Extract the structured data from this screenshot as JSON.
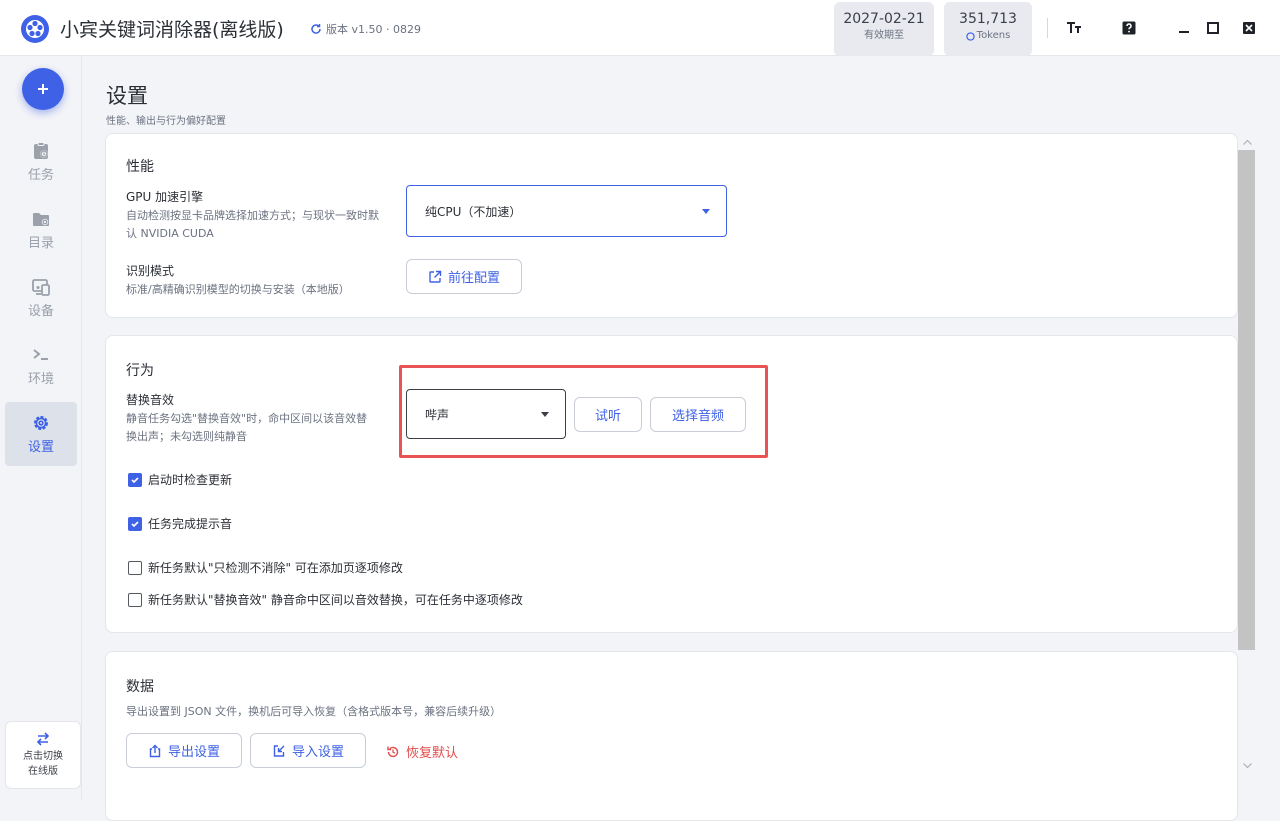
{
  "app": {
    "title": "小宾关键词消除器(离线版)",
    "version_label": "版本 v1.50 · 0829"
  },
  "stats": {
    "expiry_value": "2027-02-21",
    "expiry_label": "有效期至",
    "tokens_value": "351,713",
    "tokens_label": "Tokens"
  },
  "sidebar": {
    "items": [
      {
        "label": "任务",
        "icon": "task-icon"
      },
      {
        "label": "目录",
        "icon": "folder-icon"
      },
      {
        "label": "设备",
        "icon": "device-icon"
      },
      {
        "label": "环境",
        "icon": "terminal-icon"
      },
      {
        "label": "设置",
        "icon": "gear-icon",
        "active": true
      }
    ],
    "switch_line1": "点击切换",
    "switch_line2": "在线版"
  },
  "page": {
    "title": "设置",
    "subtitle": "性能、输出与行为偏好配置"
  },
  "performance": {
    "title": "性能",
    "gpu_label": "GPU 加速引擎",
    "gpu_desc": "自动检测按显卡品牌选择加速方式；与现状一致时默认 NVIDIA CUDA",
    "gpu_value": "纯CPU（不加速）",
    "mode_label": "识别模式",
    "mode_desc": "标准/高精确识别模型的切换与安装（本地版）",
    "mode_button": "前往配置"
  },
  "behavior": {
    "title": "行为",
    "sound_label": "替换音效",
    "sound_desc": "静音任务勾选\"替换音效\"时，命中区间以该音效替换出声；未勾选则纯静音",
    "sound_value": "哔声",
    "preview_button": "试听",
    "choose_button": "选择音频",
    "checkboxes": [
      {
        "label": "启动时检查更新",
        "checked": true
      },
      {
        "label": "任务完成提示音",
        "checked": true
      },
      {
        "label": "新任务默认\"只检测不消除\" 可在添加页逐项修改",
        "checked": false
      },
      {
        "label": "新任务默认\"替换音效\" 静音命中区间以音效替换，可在任务中逐项修改",
        "checked": false
      }
    ]
  },
  "data_section": {
    "title": "数据",
    "desc": "导出设置到 JSON 文件，换机后可导入恢复（含格式版本号，兼容后续升级）",
    "export_button": "导出设置",
    "import_button": "导入设置",
    "reset_button": "恢复默认"
  },
  "colors": {
    "accent": "#3e61e6",
    "danger": "#e34b4b",
    "highlight": "#e95353"
  }
}
